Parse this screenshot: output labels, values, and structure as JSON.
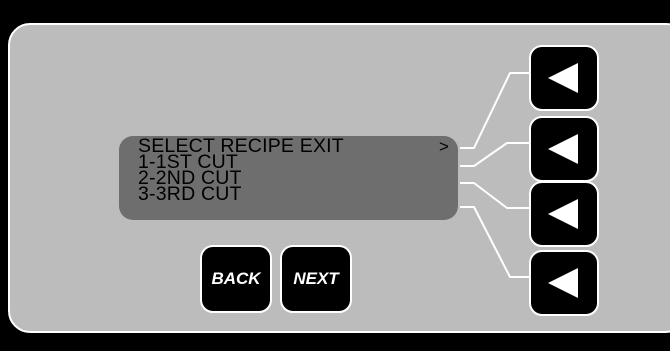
{
  "lcd": {
    "lines": [
      "SELECT RECIPE EXIT",
      "1-1ST CUT",
      "2-2ND CUT",
      "3-3RD CUT"
    ],
    "cursor": ">"
  },
  "softkeys": [
    {
      "icon": "left-triangle-icon"
    },
    {
      "icon": "left-triangle-icon"
    },
    {
      "icon": "left-triangle-icon"
    },
    {
      "icon": "left-triangle-icon"
    }
  ],
  "nav": {
    "back_label": "BACK",
    "next_label": "NEXT"
  },
  "colors": {
    "background": "#000000",
    "panel": "#bcbcbc",
    "lcd": "#6e6e6e",
    "button": "#000000",
    "outline": "#ffffff"
  }
}
